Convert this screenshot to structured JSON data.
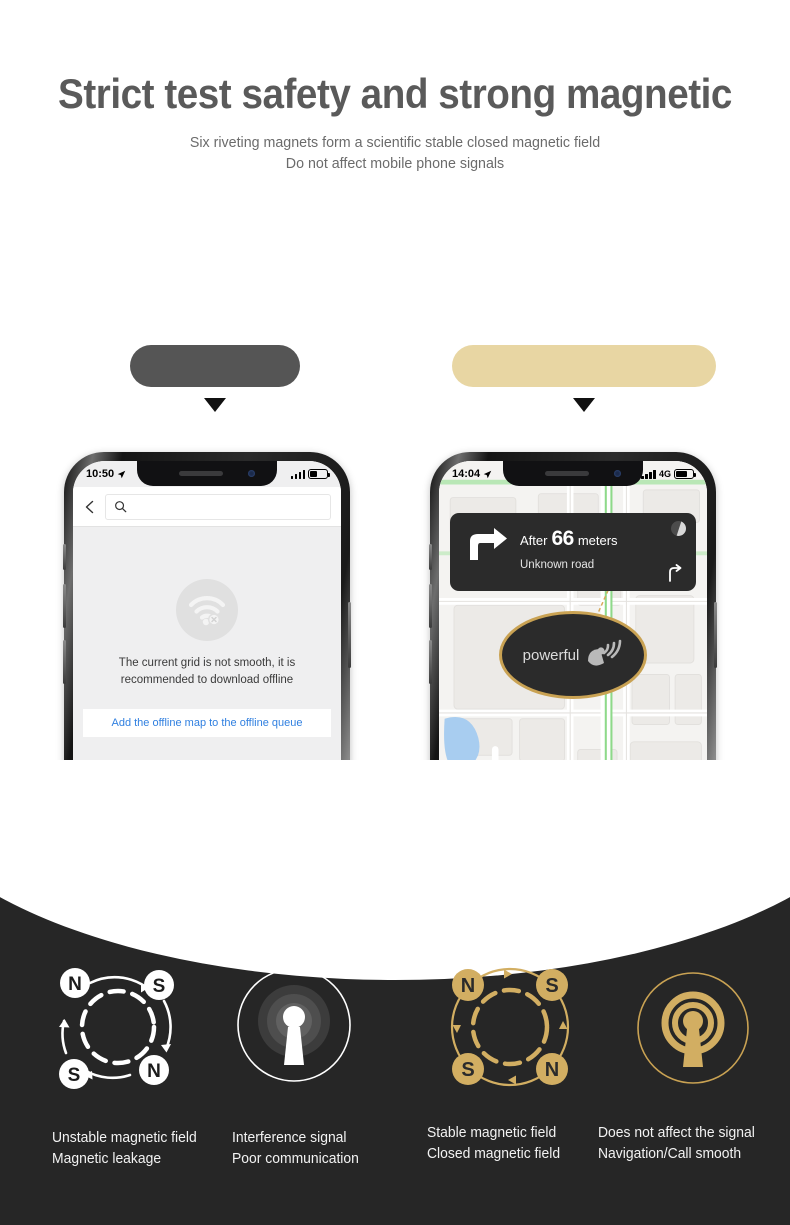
{
  "header": {
    "title": "Strict test safety and strong magnetic",
    "subtitle_line1": "Six riveting magnets form a scientific stable closed magnetic field",
    "subtitle_line2": "Do not affect mobile phone signals"
  },
  "colors": {
    "title_gray": "#5a5a5a",
    "pill_dark": "#555555",
    "pill_gold": "#e8d6a3",
    "dark_section": "#262626",
    "gold_accent": "#c9a253",
    "link_blue": "#2f7fe0",
    "map_green": "#8ed98a",
    "map_water": "#a8cdf0"
  },
  "pills": {
    "left_label": "",
    "right_label": ""
  },
  "phone_left": {
    "status": {
      "time": "10:50",
      "location_icon": "location-arrow-icon",
      "signal_icon": "signal-bars-icon",
      "battery_icon": "battery-icon"
    },
    "search": {
      "back_icon": "back-chevron-icon",
      "search_icon": "search-icon",
      "placeholder": ""
    },
    "empty_state": {
      "icon": "wifi-off-icon",
      "message_line1": "The current grid is not smooth, it is",
      "message_line2": "recommended to download offline"
    },
    "action_button": "Add the offline map to the offline queue"
  },
  "phone_right": {
    "status": {
      "time": "14:04",
      "location_icon": "location-arrow-icon",
      "signal_icon": "signal-bars-icon",
      "network": "4G",
      "battery_icon": "battery-icon"
    },
    "nav_card": {
      "turn_icon": "turn-right-icon",
      "prefix": "After",
      "distance": "66",
      "unit": "meters",
      "road": "Unknown road",
      "compass_icon": "compass-icon",
      "next_turn_icon": "next-turn-icon"
    },
    "badge": {
      "label": "powerful",
      "icon": "satellite-dish-icon"
    }
  },
  "features": [
    {
      "icon": "unstable-magnetic-field-icon",
      "poles": [
        "N",
        "S",
        "S",
        "N"
      ],
      "label_line1": "Unstable magnetic field",
      "label_line2": "Magnetic leakage",
      "tone": "white"
    },
    {
      "icon": "interference-signal-tower-icon",
      "label_line1": "Interference signal",
      "label_line2": "Poor communication",
      "tone": "white"
    },
    {
      "icon": "stable-magnetic-field-icon",
      "poles": [
        "N",
        "S",
        "S",
        "N"
      ],
      "label_line1": "Stable magnetic field",
      "label_line2": "Closed magnetic field",
      "tone": "gold"
    },
    {
      "icon": "clear-signal-tower-icon",
      "label_line1": "Does not affect the signal",
      "label_line2": "Navigation/Call smooth",
      "tone": "gold"
    }
  ]
}
